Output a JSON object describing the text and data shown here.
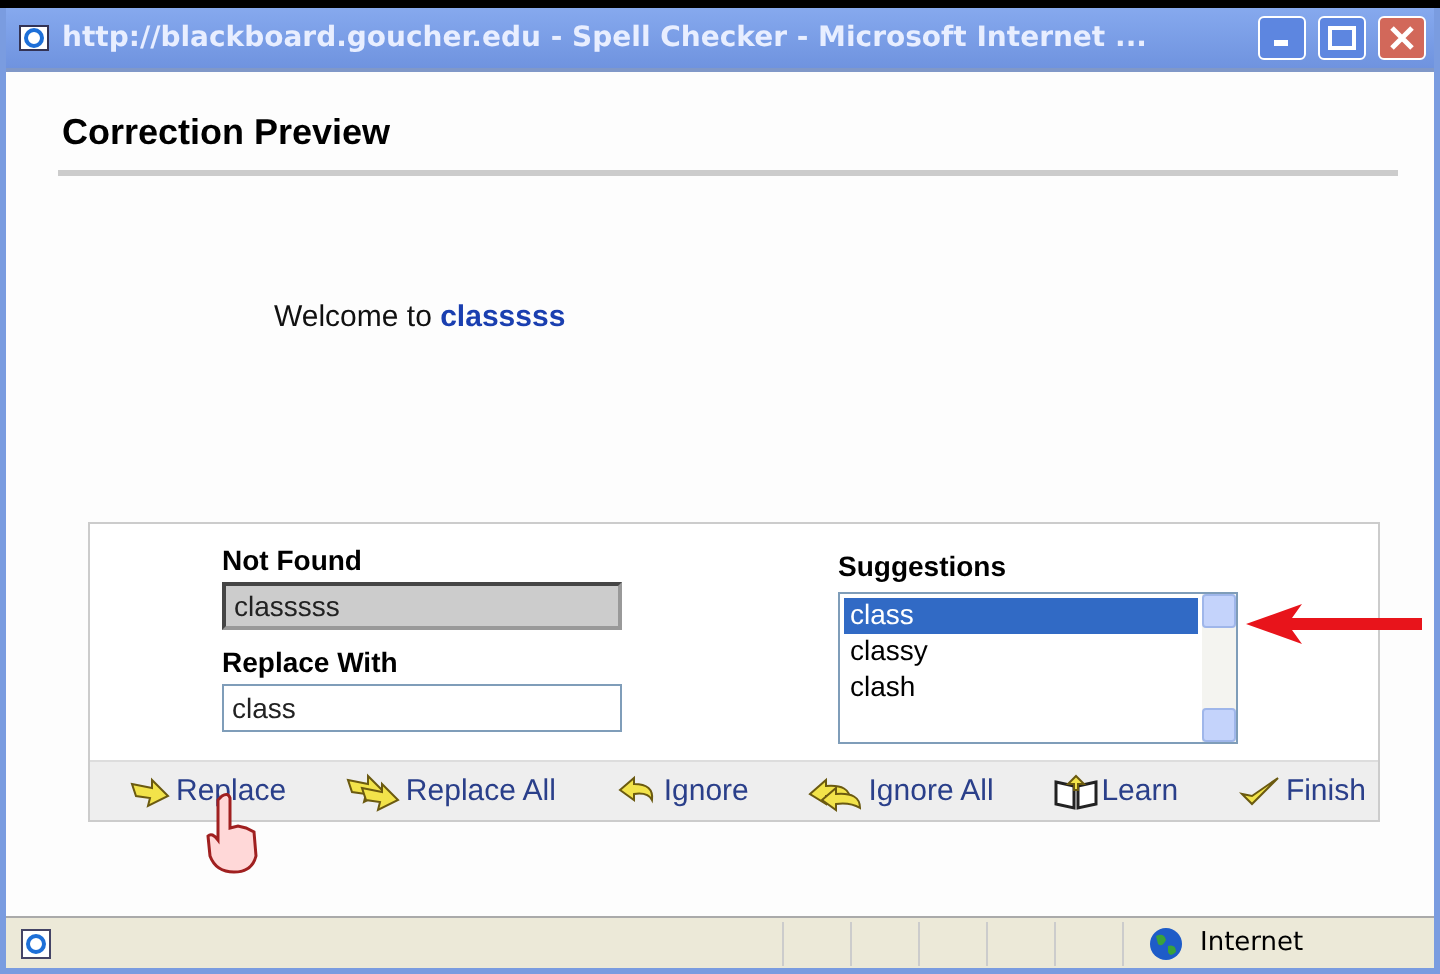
{
  "window": {
    "title": "http://blackboard.goucher.edu - Spell Checker - Microsoft Internet ..."
  },
  "heading": "Correction Preview",
  "preview": {
    "text": "Welcome to",
    "misspelled": "classsss"
  },
  "not_found": {
    "label": "Not Found",
    "value": "classsss",
    "disabled": true
  },
  "replace_with": {
    "label": "Replace With",
    "value": "class"
  },
  "suggestions": {
    "label": "Suggestions",
    "items": [
      {
        "label": "class",
        "selected": true
      },
      {
        "label": "classy",
        "selected": false
      },
      {
        "label": "clash",
        "selected": false
      }
    ]
  },
  "actions": [
    {
      "label": "Replace",
      "kind": "replace"
    },
    {
      "label": "Replace All",
      "kind": "replace_all"
    },
    {
      "label": "Ignore",
      "kind": "ignore"
    },
    {
      "label": "Ignore All",
      "kind": "ignore_all"
    },
    {
      "label": "Learn",
      "kind": "learn"
    },
    {
      "label": "Finish",
      "kind": "finish"
    }
  ],
  "status_bar": {
    "zone": "Internet"
  }
}
